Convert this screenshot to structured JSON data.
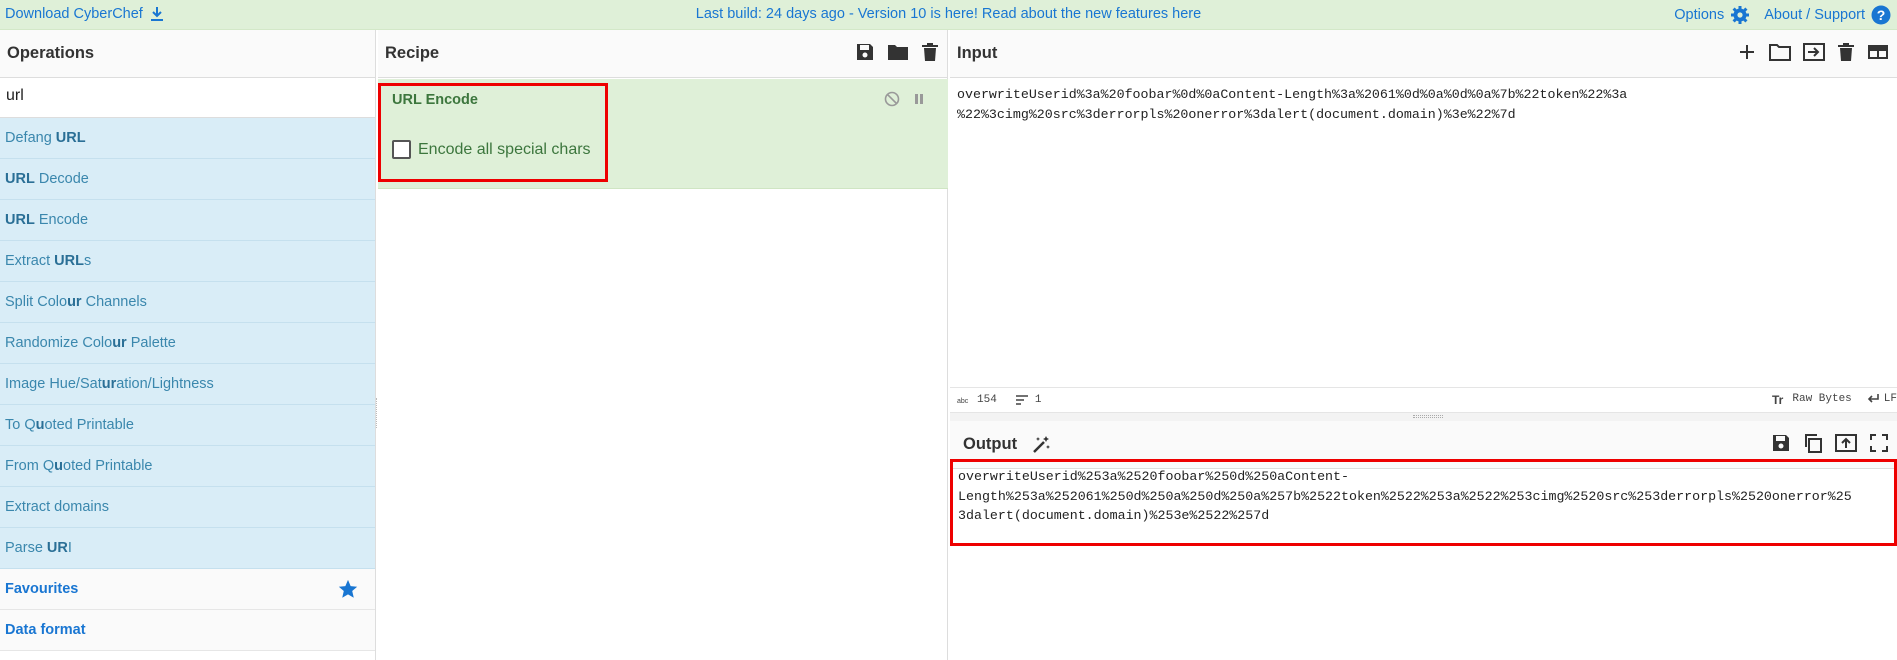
{
  "banner": {
    "download_label": "Download CyberChef",
    "center_text": "Last build: 24 days ago - Version 10 is here! Read about the new features here",
    "options_label": "Options",
    "about_label": "About / Support"
  },
  "operations": {
    "title": "Operations",
    "search_value": "url",
    "items": [
      {
        "pre": "Defang ",
        "bold": "URL",
        "post": ""
      },
      {
        "pre": "",
        "bold": "URL",
        "post": " Decode"
      },
      {
        "pre": "",
        "bold": "URL",
        "post": " Encode"
      },
      {
        "pre": "Extract ",
        "bold": "URL",
        "post": "s"
      },
      {
        "pre": "Split Colo",
        "bold": "ur",
        "post": " Channels"
      },
      {
        "pre": "Randomize Colo",
        "bold": "ur",
        "post": " Palette"
      },
      {
        "pre": "Image Hue/Sat",
        "bold": "ur",
        "post": "ation/Lightness"
      },
      {
        "pre": "To Q",
        "bold": "u",
        "post": "oted Printable"
      },
      {
        "pre": "From Q",
        "bold": "u",
        "post": "oted Printable"
      },
      {
        "pre": "Extract domains",
        "bold": "",
        "post": ""
      },
      {
        "pre": "Parse ",
        "bold": "UR",
        "post": "I"
      }
    ],
    "categories": [
      "Favourites",
      "Data format"
    ]
  },
  "recipe": {
    "title": "Recipe",
    "op_name": "URL Encode",
    "option_label": "Encode all special chars",
    "option_checked": false
  },
  "input": {
    "title": "Input",
    "text": "overwriteUserid%3a%20foobar%0d%0aContent-Length%3a%2061%0d%0a%0d%0a%7b%22token%22%3a\n%22%3cimg%20src%3derrorpls%20onerror%3dalert(document.domain)%3e%22%7d",
    "char_count": "154",
    "line_count": "1",
    "encoding": "Raw Bytes",
    "eol": "LF"
  },
  "output": {
    "title": "Output",
    "text": "overwriteUserid%253a%2520foobar%250d%250aContent-\nLength%253a%252061%250d%250a%250d%250a%257b%2522token%2522%253a%2522%253cimg%2520src%253derrorpls%2520onerror%25\n3dalert(document.domain)%253e%2522%257d"
  },
  "colors": {
    "accent": "#1976d2",
    "banner_bg": "#dff0d8",
    "op_bg": "#d9edf7",
    "highlight": "#ee0000"
  }
}
